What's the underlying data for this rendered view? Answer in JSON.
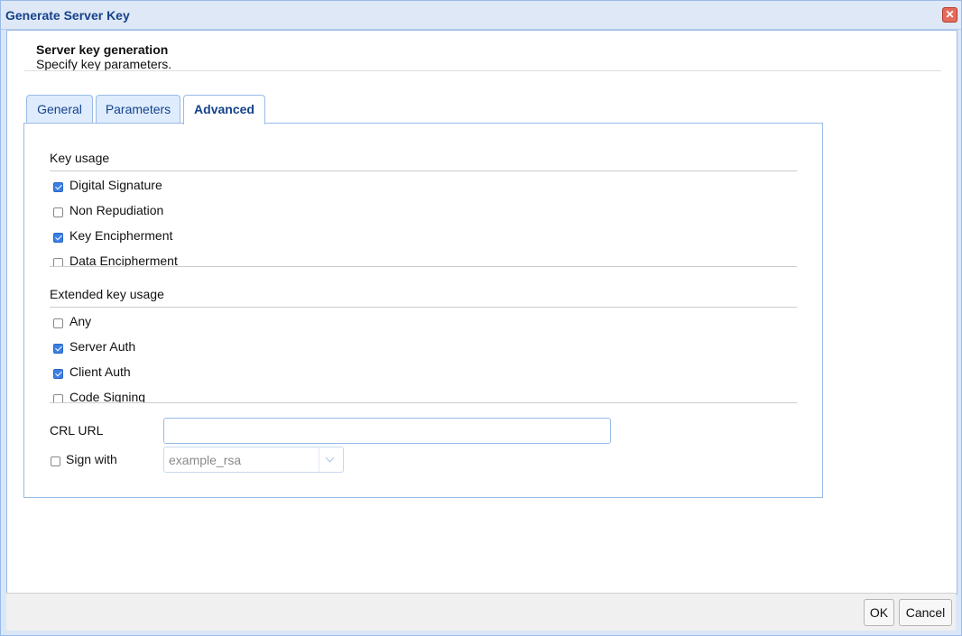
{
  "window": {
    "title": "Generate Server Key"
  },
  "header": {
    "title": "Server key generation",
    "subtitle": "Specify key parameters."
  },
  "tabs": [
    {
      "label": "General",
      "active": false
    },
    {
      "label": "Parameters",
      "active": false
    },
    {
      "label": "Advanced",
      "active": true
    }
  ],
  "key_usage": {
    "label": "Key usage",
    "items": [
      {
        "label": "Digital Signature",
        "checked": true
      },
      {
        "label": "Non Repudiation",
        "checked": false
      },
      {
        "label": "Key Encipherment",
        "checked": true
      },
      {
        "label": "Data Encipherment",
        "checked": false
      }
    ]
  },
  "extended_key_usage": {
    "label": "Extended key usage",
    "items": [
      {
        "label": "Any",
        "checked": false
      },
      {
        "label": "Server Auth",
        "checked": true
      },
      {
        "label": "Client Auth",
        "checked": true
      },
      {
        "label": "Code Signing",
        "checked": false
      }
    ]
  },
  "crl_url": {
    "label": "CRL URL",
    "value": ""
  },
  "sign_with": {
    "label": "Sign with",
    "checked": false,
    "selected": "example_rsa"
  },
  "footer": {
    "ok_label": "OK",
    "cancel_label": "Cancel"
  },
  "colors": {
    "accent": "#15428b",
    "border": "#99bbe8",
    "checkbox_checked": "#3a7fe6"
  }
}
